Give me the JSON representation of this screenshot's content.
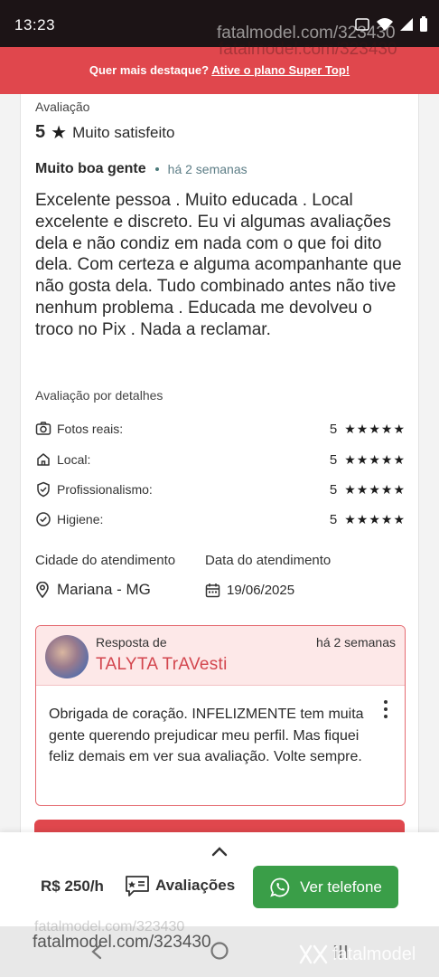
{
  "status": {
    "time": "13:23"
  },
  "watermark": {
    "text": "fatalmodel.com/323430",
    "logo": "fatalmodel"
  },
  "promo": {
    "text": "Quer mais destaque?",
    "link": "Ative o plano Super Top!"
  },
  "review": {
    "rating_label": "Avaliação",
    "rating_value": "5",
    "rating_text": "Muito satisfeito",
    "title": "Muito boa gente",
    "when": "há 2 semanas",
    "body": "Excelente pessoa . Muito educada . Local excelente e discreto. Eu vi algumas avaliações dela e não condiz em nada com o que foi dito dela. Com certeza e alguma acompanhante que não gosta dela. Tudo combinado antes não tive nenhum problema . Educada me devolveu o troco no Pix . Nada a reclamar.",
    "details_label": "Avaliação por detalhes",
    "details": [
      {
        "label": "Fotos reais:",
        "value": "5",
        "icon": "camera-icon"
      },
      {
        "label": "Local:",
        "value": "5",
        "icon": "home-icon"
      },
      {
        "label": "Profissionalismo:",
        "value": "5",
        "icon": "shield-check-icon"
      },
      {
        "label": "Higiene:",
        "value": "5",
        "icon": "check-circle-icon"
      }
    ],
    "stars": "★★★★★",
    "city_label": "Cidade do atendimento",
    "city": "Mariana - MG",
    "date_label": "Data do atendimento",
    "date": "19/06/2025"
  },
  "reply": {
    "from_label": "Resposta de",
    "name": "TALYTA TrAVesti",
    "when": "há 2 semanas",
    "text": "Obrigada de coração. INFELIZMENTE tem muita gente querendo prejudicar meu perfil. Mas fiquei feliz demais em ver sua avaliação. Volte sempre."
  },
  "bottom": {
    "price": "R$ 250/h",
    "reviews_label": "Avaliações",
    "phone_label": "Ver telefone"
  },
  "colors": {
    "accent": "#e0474d",
    "green": "#3a9e48",
    "reply_bg": "#fde8e8"
  }
}
